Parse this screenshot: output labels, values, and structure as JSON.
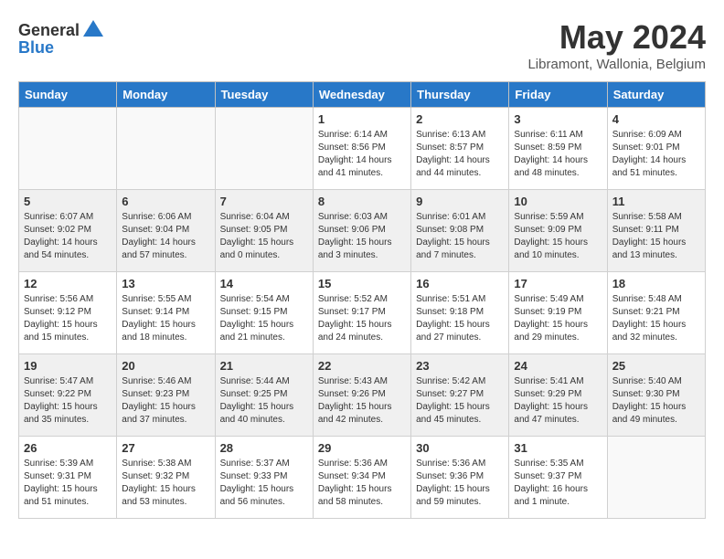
{
  "header": {
    "logo_general": "General",
    "logo_blue": "Blue",
    "month_title": "May 2024",
    "location": "Libramont, Wallonia, Belgium"
  },
  "days_of_week": [
    "Sunday",
    "Monday",
    "Tuesday",
    "Wednesday",
    "Thursday",
    "Friday",
    "Saturday"
  ],
  "weeks": [
    [
      {
        "day": "",
        "info": ""
      },
      {
        "day": "",
        "info": ""
      },
      {
        "day": "",
        "info": ""
      },
      {
        "day": "1",
        "info": "Sunrise: 6:14 AM\nSunset: 8:56 PM\nDaylight: 14 hours\nand 41 minutes."
      },
      {
        "day": "2",
        "info": "Sunrise: 6:13 AM\nSunset: 8:57 PM\nDaylight: 14 hours\nand 44 minutes."
      },
      {
        "day": "3",
        "info": "Sunrise: 6:11 AM\nSunset: 8:59 PM\nDaylight: 14 hours\nand 48 minutes."
      },
      {
        "day": "4",
        "info": "Sunrise: 6:09 AM\nSunset: 9:01 PM\nDaylight: 14 hours\nand 51 minutes."
      }
    ],
    [
      {
        "day": "5",
        "info": "Sunrise: 6:07 AM\nSunset: 9:02 PM\nDaylight: 14 hours\nand 54 minutes."
      },
      {
        "day": "6",
        "info": "Sunrise: 6:06 AM\nSunset: 9:04 PM\nDaylight: 14 hours\nand 57 minutes."
      },
      {
        "day": "7",
        "info": "Sunrise: 6:04 AM\nSunset: 9:05 PM\nDaylight: 15 hours\nand 0 minutes."
      },
      {
        "day": "8",
        "info": "Sunrise: 6:03 AM\nSunset: 9:06 PM\nDaylight: 15 hours\nand 3 minutes."
      },
      {
        "day": "9",
        "info": "Sunrise: 6:01 AM\nSunset: 9:08 PM\nDaylight: 15 hours\nand 7 minutes."
      },
      {
        "day": "10",
        "info": "Sunrise: 5:59 AM\nSunset: 9:09 PM\nDaylight: 15 hours\nand 10 minutes."
      },
      {
        "day": "11",
        "info": "Sunrise: 5:58 AM\nSunset: 9:11 PM\nDaylight: 15 hours\nand 13 minutes."
      }
    ],
    [
      {
        "day": "12",
        "info": "Sunrise: 5:56 AM\nSunset: 9:12 PM\nDaylight: 15 hours\nand 15 minutes."
      },
      {
        "day": "13",
        "info": "Sunrise: 5:55 AM\nSunset: 9:14 PM\nDaylight: 15 hours\nand 18 minutes."
      },
      {
        "day": "14",
        "info": "Sunrise: 5:54 AM\nSunset: 9:15 PM\nDaylight: 15 hours\nand 21 minutes."
      },
      {
        "day": "15",
        "info": "Sunrise: 5:52 AM\nSunset: 9:17 PM\nDaylight: 15 hours\nand 24 minutes."
      },
      {
        "day": "16",
        "info": "Sunrise: 5:51 AM\nSunset: 9:18 PM\nDaylight: 15 hours\nand 27 minutes."
      },
      {
        "day": "17",
        "info": "Sunrise: 5:49 AM\nSunset: 9:19 PM\nDaylight: 15 hours\nand 29 minutes."
      },
      {
        "day": "18",
        "info": "Sunrise: 5:48 AM\nSunset: 9:21 PM\nDaylight: 15 hours\nand 32 minutes."
      }
    ],
    [
      {
        "day": "19",
        "info": "Sunrise: 5:47 AM\nSunset: 9:22 PM\nDaylight: 15 hours\nand 35 minutes."
      },
      {
        "day": "20",
        "info": "Sunrise: 5:46 AM\nSunset: 9:23 PM\nDaylight: 15 hours\nand 37 minutes."
      },
      {
        "day": "21",
        "info": "Sunrise: 5:44 AM\nSunset: 9:25 PM\nDaylight: 15 hours\nand 40 minutes."
      },
      {
        "day": "22",
        "info": "Sunrise: 5:43 AM\nSunset: 9:26 PM\nDaylight: 15 hours\nand 42 minutes."
      },
      {
        "day": "23",
        "info": "Sunrise: 5:42 AM\nSunset: 9:27 PM\nDaylight: 15 hours\nand 45 minutes."
      },
      {
        "day": "24",
        "info": "Sunrise: 5:41 AM\nSunset: 9:29 PM\nDaylight: 15 hours\nand 47 minutes."
      },
      {
        "day": "25",
        "info": "Sunrise: 5:40 AM\nSunset: 9:30 PM\nDaylight: 15 hours\nand 49 minutes."
      }
    ],
    [
      {
        "day": "26",
        "info": "Sunrise: 5:39 AM\nSunset: 9:31 PM\nDaylight: 15 hours\nand 51 minutes."
      },
      {
        "day": "27",
        "info": "Sunrise: 5:38 AM\nSunset: 9:32 PM\nDaylight: 15 hours\nand 53 minutes."
      },
      {
        "day": "28",
        "info": "Sunrise: 5:37 AM\nSunset: 9:33 PM\nDaylight: 15 hours\nand 56 minutes."
      },
      {
        "day": "29",
        "info": "Sunrise: 5:36 AM\nSunset: 9:34 PM\nDaylight: 15 hours\nand 58 minutes."
      },
      {
        "day": "30",
        "info": "Sunrise: 5:36 AM\nSunset: 9:36 PM\nDaylight: 15 hours\nand 59 minutes."
      },
      {
        "day": "31",
        "info": "Sunrise: 5:35 AM\nSunset: 9:37 PM\nDaylight: 16 hours\nand 1 minute."
      },
      {
        "day": "",
        "info": ""
      }
    ]
  ]
}
